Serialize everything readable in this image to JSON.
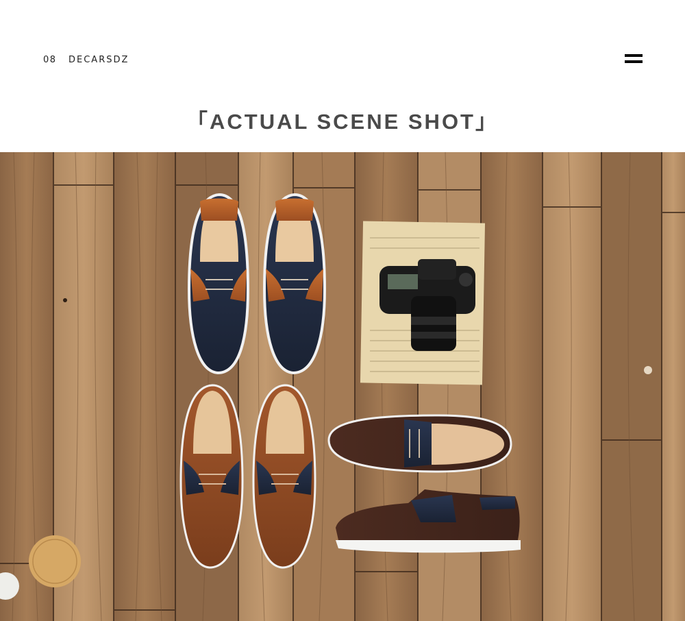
{
  "header": {
    "number": "08",
    "brand": "DECARSDZ",
    "menu_icon": "hamburger-menu-icon"
  },
  "section": {
    "title": "「ACTUAL SCENE SHOT」"
  },
  "photo": {
    "subject": "product-scene-photo",
    "colors": {
      "wood": "#9c7550",
      "navy": "#1f2a3d",
      "tan": "#b5622b",
      "brown": "#4a2a1f"
    }
  }
}
